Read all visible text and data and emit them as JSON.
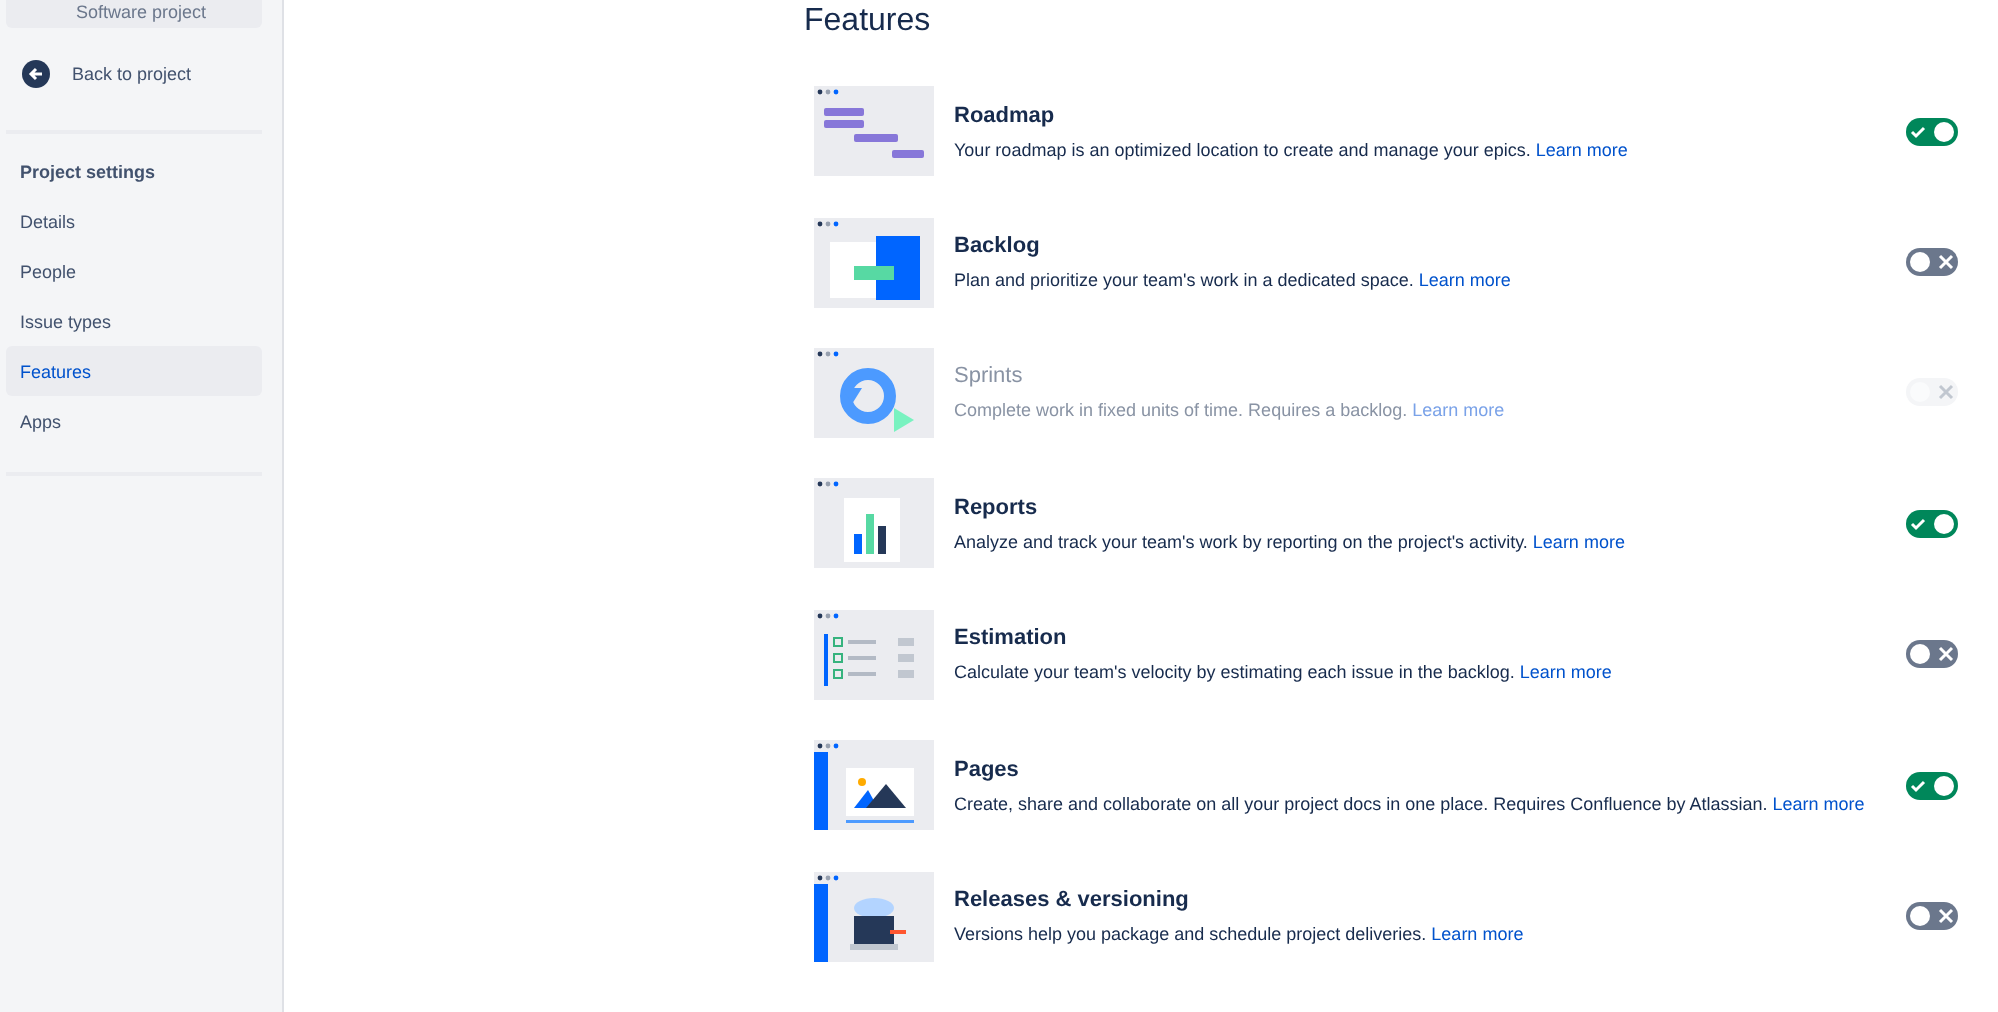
{
  "sidebar": {
    "project": "Software project",
    "back": "Back to project",
    "section": "Project settings",
    "items": [
      {
        "label": "Details",
        "selected": false
      },
      {
        "label": "People",
        "selected": false
      },
      {
        "label": "Issue types",
        "selected": false
      },
      {
        "label": "Features",
        "selected": true
      },
      {
        "label": "Apps",
        "selected": false
      }
    ]
  },
  "heading": "Features",
  "features": [
    {
      "kind": "roadmap",
      "title": "Roadmap",
      "description": "Your roadmap is an optimized location to create and manage your epics.",
      "link": "Learn more",
      "on": true,
      "disabled": false
    },
    {
      "kind": "backlog",
      "title": "Backlog",
      "description": "Plan and prioritize your team's work in a dedicated space.",
      "link": "Learn more",
      "on": false,
      "disabled": false
    },
    {
      "kind": "sprints",
      "title": "Sprints",
      "description": "Complete work in fixed units of time. Requires a backlog.",
      "link": "Learn more",
      "on": false,
      "disabled": true
    },
    {
      "kind": "reports",
      "title": "Reports",
      "description": "Analyze and track your team's work by reporting on the project's activity.",
      "link": "Learn more",
      "on": true,
      "disabled": false
    },
    {
      "kind": "estimation",
      "title": "Estimation",
      "description": "Calculate your team's velocity by estimating each issue in the backlog.",
      "link": "Learn more",
      "on": false,
      "disabled": false
    },
    {
      "kind": "pages",
      "title": "Pages",
      "description": "Create, share and collaborate on all your project docs in one place. Requires Confluence by Atlassian.",
      "link": "Learn more",
      "on": true,
      "disabled": false
    },
    {
      "kind": "releases",
      "title": "Releases & versioning",
      "description": "Versions help you package and schedule project deliveries.",
      "link": "Learn more",
      "on": false,
      "disabled": false
    }
  ]
}
